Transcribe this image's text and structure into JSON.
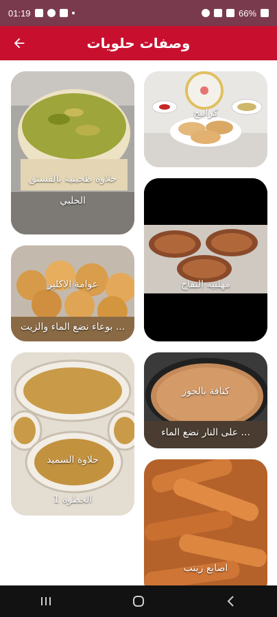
{
  "status_bar": {
    "time": "01:19",
    "battery": "66%"
  },
  "app_bar": {
    "title": "وصفات حلويات",
    "back_icon": "arrow-left-icon",
    "color": "#c8102e"
  },
  "recipes": {
    "right_column": [
      {
        "title": "كرابيج",
        "subtitle": ""
      },
      {
        "title": "مهلبية التفاح",
        "subtitle": ""
      },
      {
        "title": "كنافة بالجوز",
        "subtitle": "على النار نضع الماء ..."
      },
      {
        "title": "اصابع زينب",
        "subtitle": ""
      }
    ],
    "left_column": [
      {
        "title": "حلاوة طحينية بالفستق",
        "subtitle": "الحلبي"
      },
      {
        "title": "عوامة الاكلير",
        "subtitle": "بوعاء نضع الماء والزيت ..."
      },
      {
        "title": "حلاوة السميد",
        "subtitle": "الخطوة 1"
      }
    ]
  },
  "nav": {
    "recents_icon": "recents-icon",
    "home_icon": "home-icon",
    "back_icon": "back-nav-icon"
  }
}
